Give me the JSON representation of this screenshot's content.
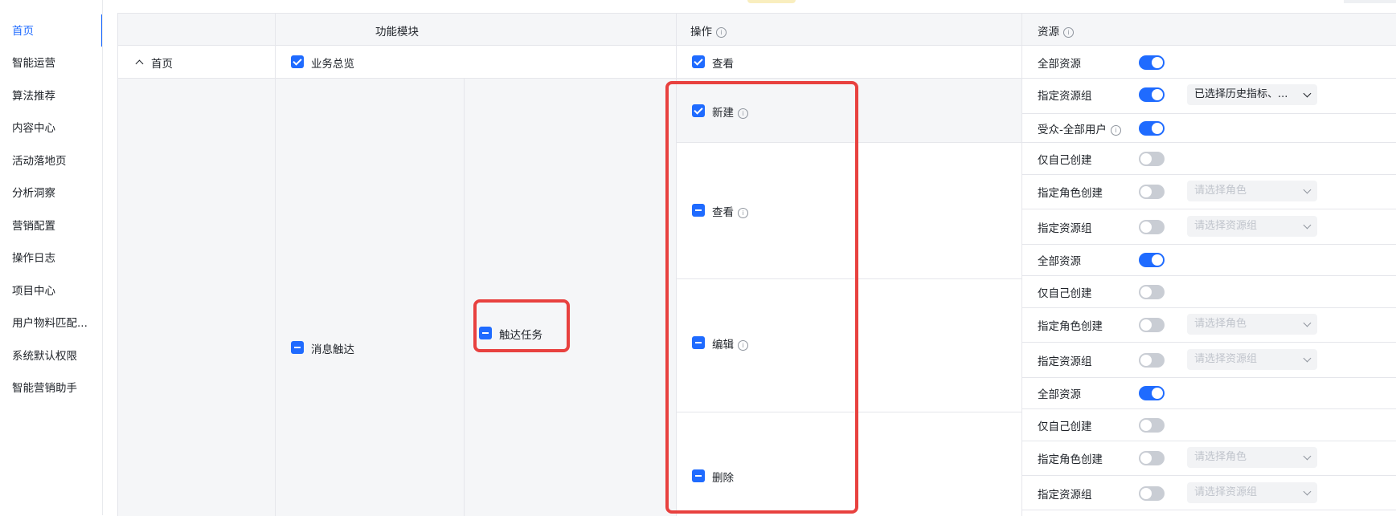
{
  "sidebar": {
    "items": [
      {
        "label": "首页",
        "active": true
      },
      {
        "label": "智能运营"
      },
      {
        "label": "算法推荐"
      },
      {
        "label": "内容中心"
      },
      {
        "label": "活动落地页"
      },
      {
        "label": "分析洞察"
      },
      {
        "label": "营销配置"
      },
      {
        "label": "操作日志"
      },
      {
        "label": "项目中心"
      },
      {
        "label": "用户物料匹配..."
      },
      {
        "label": "系统默认权限"
      },
      {
        "label": "智能营销助手"
      }
    ]
  },
  "table": {
    "headers": {
      "module": "功能模块",
      "operation": "操作",
      "resource": "资源",
      "info_icon": "info-icon"
    },
    "row_home": {
      "module": "首页",
      "submodule": "业务总览",
      "operation": "查看",
      "resource_label": "全部资源",
      "resource_on": true
    },
    "row_message": {
      "module": "消息触达",
      "submodule": "触达任务",
      "operations": {
        "create": "新建",
        "view": "查看",
        "edit": "编辑",
        "delete": "删除"
      },
      "create_resources": [
        {
          "label": "指定资源组",
          "on": true,
          "select": "已选择历史指标、..."
        },
        {
          "label": "受众-全部用户",
          "on": true,
          "info": true
        }
      ],
      "view_resources": [
        {
          "label": "仅自己创建",
          "on": false
        },
        {
          "label": "指定角色创建",
          "on": false,
          "select_placeholder": "请选择角色"
        },
        {
          "label": "指定资源组",
          "on": false,
          "select_placeholder": "请选择资源组"
        },
        {
          "label": "全部资源",
          "on": true
        }
      ],
      "edit_resources": [
        {
          "label": "仅自己创建",
          "on": false
        },
        {
          "label": "指定角色创建",
          "on": false,
          "select_placeholder": "请选择角色"
        },
        {
          "label": "指定资源组",
          "on": false,
          "select_placeholder": "请选择资源组"
        },
        {
          "label": "全部资源",
          "on": true
        }
      ],
      "delete_resources": [
        {
          "label": "仅自己创建",
          "on": false
        },
        {
          "label": "指定角色创建",
          "on": false,
          "select_placeholder": "请选择角色"
        },
        {
          "label": "指定资源组",
          "on": false,
          "select_placeholder": "请选择资源组"
        }
      ]
    }
  },
  "colors": {
    "accent": "#1f6bff",
    "highlight": "#e8413f"
  }
}
